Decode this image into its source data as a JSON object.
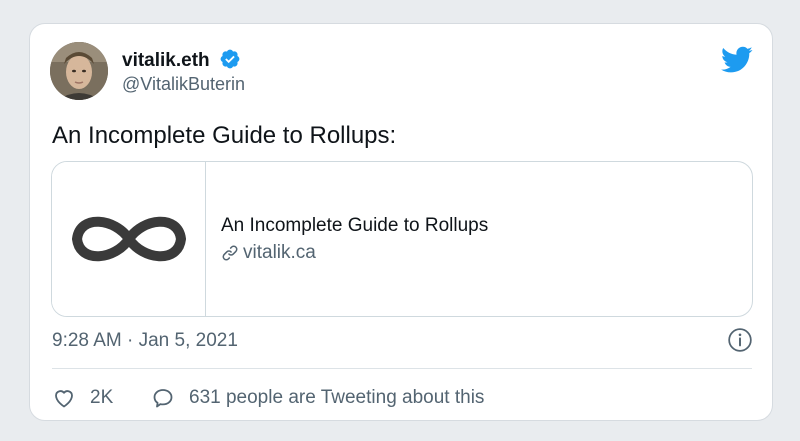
{
  "tweet": {
    "author": {
      "display_name": "vitalik.eth",
      "handle": "@VitalikButerin",
      "verified": true
    },
    "text": "An Incomplete Guide to Rollups:",
    "link_card": {
      "title": "An Incomplete Guide to Rollups",
      "domain": "vitalik.ca",
      "thumbnail_icon": "infinity-icon"
    },
    "timestamp": "9:28 AM · Jan 5, 2021",
    "likes": "2K",
    "tweeting_about": "631 people are Tweeting about this"
  },
  "icons": {
    "brand": "twitter-bird-icon",
    "verified": "verified-badge-icon",
    "link": "link-icon",
    "info": "info-icon",
    "like": "heart-icon",
    "reply": "speech-bubble-icon"
  },
  "colors": {
    "brand_blue": "#1d9bf0",
    "text": "#0f1419",
    "muted": "#536471",
    "border": "#cfd9de",
    "page_background": "#e9ecef"
  }
}
